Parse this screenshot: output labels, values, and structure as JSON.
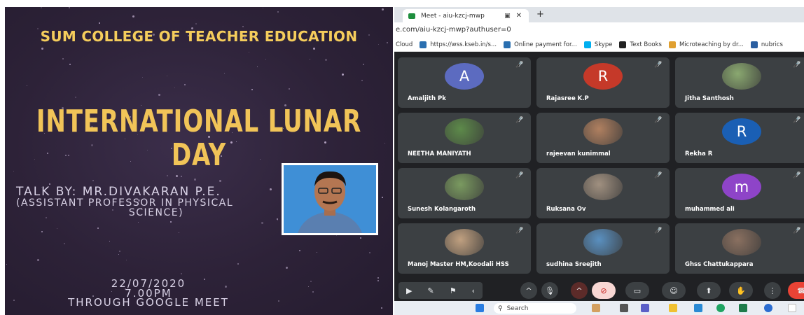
{
  "poster": {
    "college": "SUM COLLEGE OF TEACHER EDUCATION",
    "event_line1": "INTERNATIONAL LUNAR",
    "event_line2": "DAY",
    "talk_by": "TALK BY: MR.DIVAKARAN P.E.",
    "role_line1": "(ASSISTANT PROFESSOR IN PHYSICAL",
    "role_line2": "SCIENCE)",
    "date": "22/07/2020",
    "time": "7.00PM",
    "via": "THROUGH GOOGLE MEET"
  },
  "browser": {
    "tab_title": "Meet - aiu-kzcj-mwp",
    "address": "e.com/aiu-kzcj-mwp?authuser=0",
    "bookmarks": [
      {
        "label": "Cloud",
        "icon": "cloud-icon"
      },
      {
        "label": "https://wss.kseb.in/s...",
        "icon": "kseb-icon"
      },
      {
        "label": "Online payment for...",
        "icon": "payment-icon"
      },
      {
        "label": "Skype",
        "icon": "skype-icon"
      },
      {
        "label": "Text Books",
        "icon": "github-icon"
      },
      {
        "label": "Microteaching by dr...",
        "icon": "doc-icon"
      },
      {
        "label": "nubrics",
        "icon": "rubrics-icon"
      }
    ]
  },
  "meet": {
    "participants": [
      {
        "name": "Amaljith Pk",
        "initial": "A",
        "avatar_color": "#5c6bc0"
      },
      {
        "name": "Rajasree K.P",
        "initial": "R",
        "avatar_color": "#c53929"
      },
      {
        "name": "Jitha Santhosh",
        "initial": "",
        "avatar_color": "#8aa870"
      },
      {
        "name": "NEETHA MANIYATH",
        "initial": "",
        "avatar_color": "#5d8a4a"
      },
      {
        "name": "rajeevan kunimmal",
        "initial": "",
        "avatar_color": "#b08060"
      },
      {
        "name": "Rekha R",
        "initial": "R",
        "avatar_color": "#1a5fb4"
      },
      {
        "name": "Sunesh Kolangaroth",
        "initial": "",
        "avatar_color": "#7a9a60"
      },
      {
        "name": "Ruksana Ov",
        "initial": "",
        "avatar_color": "#a09080"
      },
      {
        "name": "muhammed ali",
        "initial": "m",
        "avatar_color": "#8e44c8"
      },
      {
        "name": "Manoj Master HM,Koodali HSS",
        "initial": "",
        "avatar_color": "#c0a080"
      },
      {
        "name": "sudhina Sreejith",
        "initial": "",
        "avatar_color": "#5a90c0"
      },
      {
        "name": "Ghss Chattukappara",
        "initial": "",
        "avatar_color": "#8a7060"
      }
    ]
  },
  "taskbar": {
    "search_label": "Search"
  },
  "colors": {
    "poster_bg": "#2d2238",
    "poster_title": "#f1c458",
    "meet_bg": "#202124",
    "tile_bg": "#3c4043",
    "end_call": "#ea4335"
  }
}
